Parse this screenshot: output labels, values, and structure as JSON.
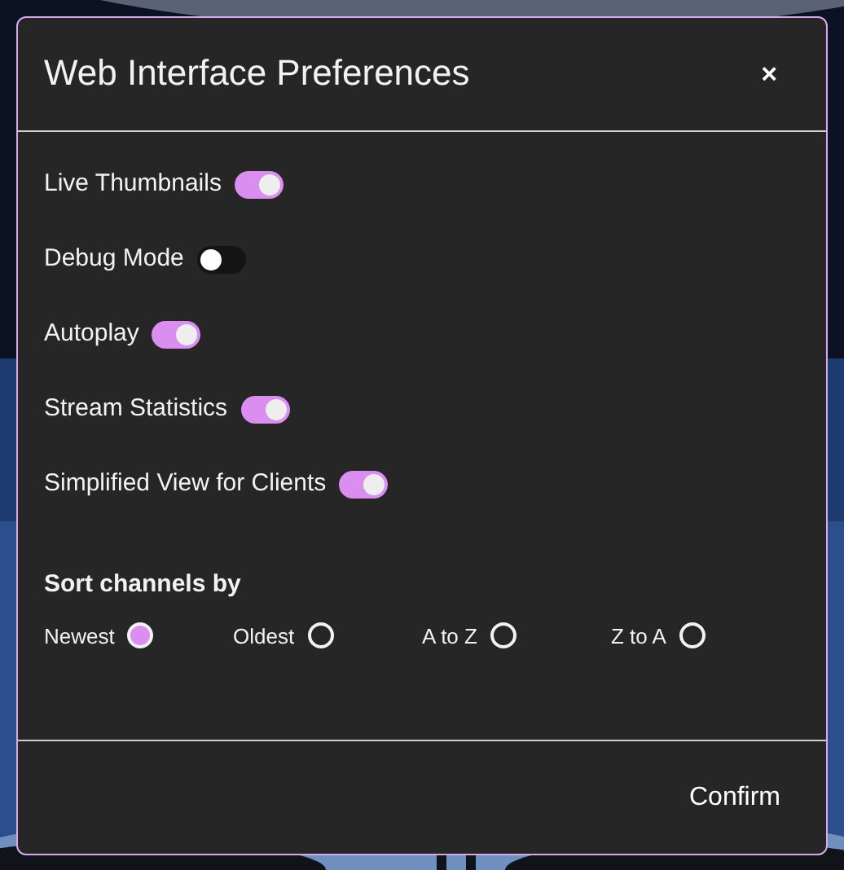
{
  "dialog": {
    "title": "Web Interface Preferences",
    "close": "×"
  },
  "toggles": [
    {
      "label": "Live Thumbnails",
      "on": true
    },
    {
      "label": "Debug Mode",
      "on": false
    },
    {
      "label": "Autoplay",
      "on": true
    },
    {
      "label": "Stream Statistics",
      "on": true
    },
    {
      "label": "Simplified View for Clients",
      "on": true
    }
  ],
  "sort": {
    "heading": "Sort channels by",
    "options": [
      {
        "label": "Newest",
        "selected": true
      },
      {
        "label": "Oldest",
        "selected": false
      },
      {
        "label": "A to Z",
        "selected": false
      },
      {
        "label": "Z to A",
        "selected": false
      }
    ]
  },
  "buttons": [
    "Confirm"
  ]
}
